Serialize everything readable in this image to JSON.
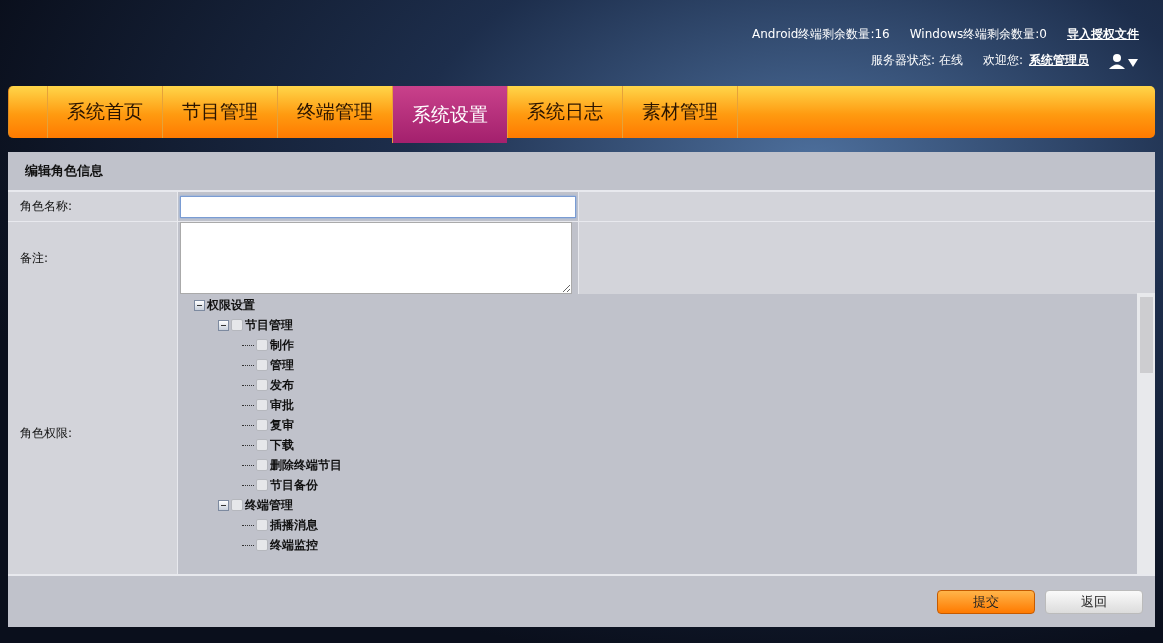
{
  "header": {
    "android_count": "Android终端剩余数量:16",
    "windows_count": "Windows终端剩余数量:0",
    "import_link": "导入授权文件",
    "server_status": "服务器状态: 在线",
    "welcome": "欢迎您:",
    "user_link": "系统管理员"
  },
  "nav": [
    {
      "label": "系统首页",
      "selected": false
    },
    {
      "label": "节目管理",
      "selected": false
    },
    {
      "label": "终端管理",
      "selected": false
    },
    {
      "label": "系统设置",
      "selected": true
    },
    {
      "label": "系统日志",
      "selected": false
    },
    {
      "label": "素材管理",
      "selected": false
    }
  ],
  "panel": {
    "title": "编辑角色信息",
    "name_label": "角色名称:",
    "remark_label": "备注:",
    "permissions_label": "角色权限:",
    "tree": {
      "label": "权限设置",
      "expanded": true,
      "children": [
        {
          "label": "节目管理",
          "checked": false,
          "expanded": true,
          "children": [
            {
              "label": "制作",
              "checked": false
            },
            {
              "label": "管理",
              "checked": false
            },
            {
              "label": "发布",
              "checked": false
            },
            {
              "label": "审批",
              "checked": false
            },
            {
              "label": "复审",
              "checked": false
            },
            {
              "label": "下载",
              "checked": false
            },
            {
              "label": "删除终端节目",
              "checked": false
            },
            {
              "label": "节目备份",
              "checked": false
            }
          ]
        },
        {
          "label": "终端管理",
          "checked": false,
          "expanded": true,
          "children": [
            {
              "label": "插播消息",
              "checked": false
            },
            {
              "label": "终端监控",
              "checked": false
            }
          ]
        }
      ]
    },
    "buttons": [
      {
        "label": "提交",
        "kind": "primary"
      },
      {
        "label": "返回",
        "kind": "secondary"
      }
    ]
  }
}
